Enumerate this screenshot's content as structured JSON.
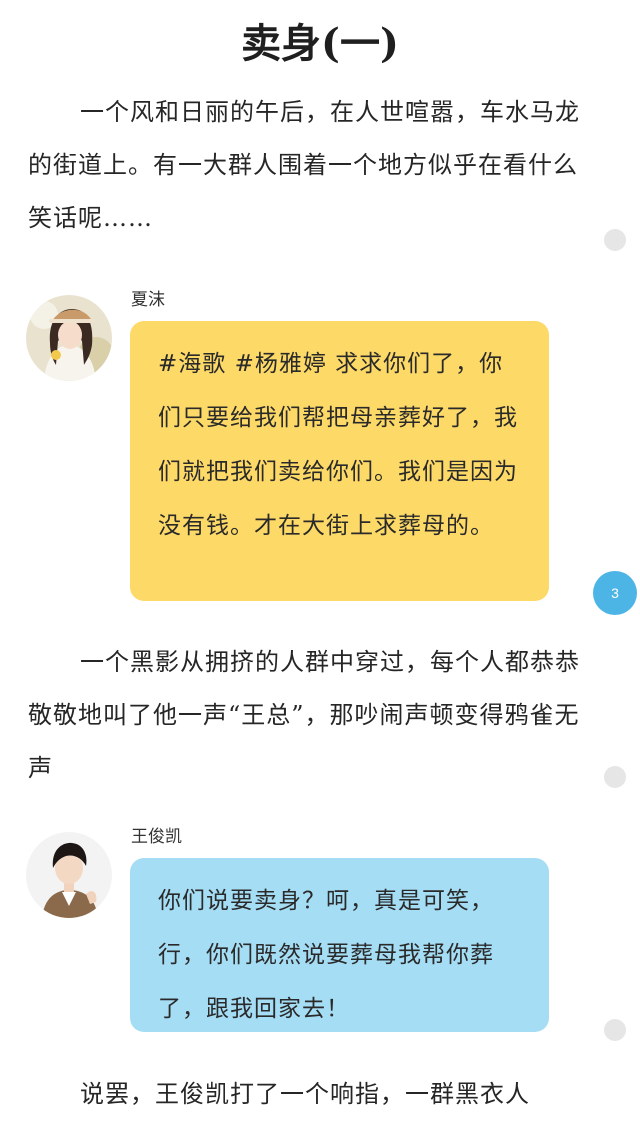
{
  "article": {
    "title": "卖身(一)"
  },
  "paragraphs": [
    "一个风和日丽的午后，在人世喧嚣，车水马龙的街道上。有一大群人围着一个地方似乎在看什么笑话呢……",
    "一个黑影从拥挤的人群中穿过，每个人都恭恭敬敬地叫了他一声“王总”，那吵闹声顿变得鸦雀无声",
    "说罢，王俊凯打了一个响指，一群黑衣人"
  ],
  "dialogues": [
    {
      "speaker": "夏沫",
      "text": "#海歌 #杨雅婷 求求你们了，你们只要给我们帮把母亲葬好了，我们就把我们卖给你们。我们是因为没有钱。才在大街上求葬母的。",
      "bubble_color": "#fdd967"
    },
    {
      "speaker": "王俊凯",
      "text": "你们说要卖身？呵，真是可笑，行，你们既然说要葬母我帮你葬了，跟我回家去！",
      "bubble_color": "#a5ddf5"
    }
  ],
  "comment_badge": {
    "count": "3"
  }
}
